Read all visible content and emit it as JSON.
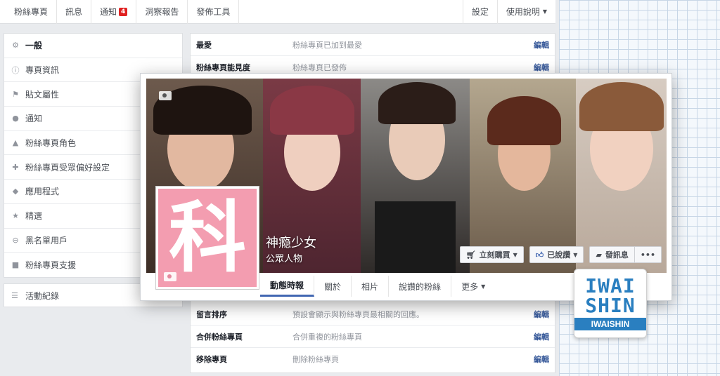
{
  "topnav": {
    "tabs": [
      "粉絲專頁",
      "訊息",
      "通知",
      "洞察報告",
      "發佈工具"
    ],
    "notif_badge": "4",
    "right": [
      "設定",
      "使用說明"
    ]
  },
  "sidebar": {
    "items": [
      {
        "label": "一般",
        "icon": "gear-icon"
      },
      {
        "label": "專頁資訊",
        "icon": "info-icon"
      },
      {
        "label": "貼文屬性",
        "icon": "flag-icon"
      },
      {
        "label": "通知",
        "icon": "globe-icon"
      },
      {
        "label": "粉絲專頁角色",
        "icon": "person-icon"
      },
      {
        "label": "粉絲專頁受眾偏好設定",
        "icon": "person-add-icon"
      },
      {
        "label": "應用程式",
        "icon": "cube-icon"
      },
      {
        "label": "精選",
        "icon": "star-icon"
      },
      {
        "label": "黑名單用戶",
        "icon": "block-icon"
      },
      {
        "label": "粉絲專頁支援",
        "icon": "facebook-icon"
      }
    ],
    "activity": {
      "label": "活動紀錄",
      "icon": "list-icon"
    }
  },
  "settings": {
    "edit_label": "編輯",
    "rows_top": [
      {
        "key": "最愛",
        "value": "粉絲專頁已加到最愛"
      },
      {
        "key": "粉絲專頁能見度",
        "value": "粉絲專頁已發佈"
      }
    ],
    "rows_bottom": [
      {
        "key": "留言排序",
        "value": "預設會顯示與粉絲專頁最相關的回應。"
      },
      {
        "key": "合併粉絲專頁",
        "value": "合併重複的粉絲專頁"
      },
      {
        "key": "移除專頁",
        "value": "刪除粉絲專頁"
      }
    ]
  },
  "page_card": {
    "profile_char": "科",
    "name": "神瘾少女",
    "category": "公眾人物",
    "buttons": {
      "buy": "立刻購買",
      "liked": "已說讚",
      "message": "發訊息",
      "more": "•••"
    },
    "tabs": [
      "動態時報",
      "關於",
      "相片",
      "說讚的粉絲",
      "更多"
    ]
  },
  "logo": {
    "line1": "IWAI",
    "line2": "SHIN",
    "line3": "IWAISHIN"
  }
}
